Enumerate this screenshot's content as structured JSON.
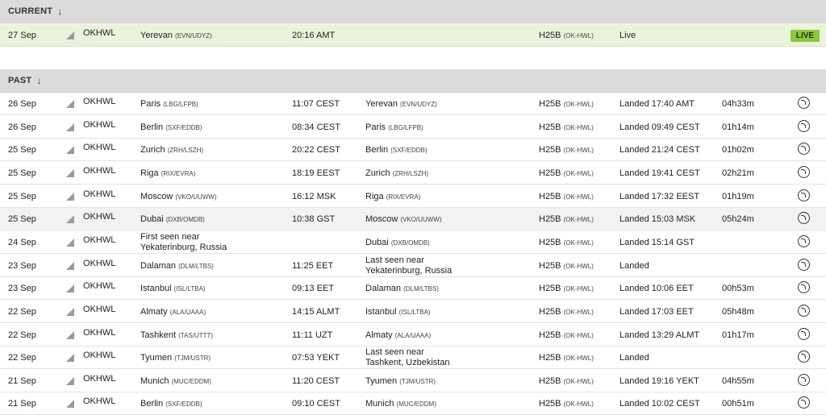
{
  "current": {
    "header": "CURRENT",
    "arrow": "↓",
    "row": {
      "date": "27 Sep",
      "reg": "OKHWL",
      "from_name": "Yerevan",
      "from_code": "(EVN/UDYZ)",
      "dep": "20:16 AMT",
      "aircraft": "H25B",
      "aircraft_reg": "(OK-HWL)",
      "status": "Live",
      "badge": "LIVE"
    }
  },
  "past": {
    "header": "PAST",
    "arrow": "↓",
    "rows": [
      {
        "date": "26 Sep",
        "reg": "OKHWL",
        "from_name": "Paris",
        "from_code": "(LBG/LFPB)",
        "from_l2": "",
        "dep": "11:07 CEST",
        "to_name": "Yerevan",
        "to_code": "(EVN/UDYZ)",
        "to_l2": "",
        "aircraft": "H25B",
        "aircraft_reg": "(OK-HWL)",
        "status": "Landed 17:40 AMT",
        "duration": "04h33m"
      },
      {
        "date": "26 Sep",
        "reg": "OKHWL",
        "from_name": "Berlin",
        "from_code": "(SXF/EDDB)",
        "from_l2": "",
        "dep": "08:34 CEST",
        "to_name": "Paris",
        "to_code": "(LBG/LFPB)",
        "to_l2": "",
        "aircraft": "H25B",
        "aircraft_reg": "(OK-HWL)",
        "status": "Landed 09:49 CEST",
        "duration": "01h14m"
      },
      {
        "date": "25 Sep",
        "reg": "OKHWL",
        "from_name": "Zurich",
        "from_code": "(ZRH/LSZH)",
        "from_l2": "",
        "dep": "20:22 CEST",
        "to_name": "Berlin",
        "to_code": "(SXF/EDDB)",
        "to_l2": "",
        "aircraft": "H25B",
        "aircraft_reg": "(OK-HWL)",
        "status": "Landed 21:24 CEST",
        "duration": "01h02m"
      },
      {
        "date": "25 Sep",
        "reg": "OKHWL",
        "from_name": "Riga",
        "from_code": "(RIX/EVRA)",
        "from_l2": "",
        "dep": "18:19 EEST",
        "to_name": "Zurich",
        "to_code": "(ZRH/LSZH)",
        "to_l2": "",
        "aircraft": "H25B",
        "aircraft_reg": "(OK-HWL)",
        "status": "Landed 19:41 CEST",
        "duration": "02h21m"
      },
      {
        "date": "25 Sep",
        "reg": "OKHWL",
        "from_name": "Moscow",
        "from_code": "(VKO/UUWW)",
        "from_l2": "",
        "dep": "16:12 MSK",
        "to_name": "Riga",
        "to_code": "(RIX/EVRA)",
        "to_l2": "",
        "aircraft": "H25B",
        "aircraft_reg": "(OK-HWL)",
        "status": "Landed 17:32 EEST",
        "duration": "01h19m"
      },
      {
        "date": "25 Sep",
        "reg": "OKHWL",
        "from_name": "Dubai",
        "from_code": "(DXB/OMDB)",
        "from_l2": "",
        "dep": "10:38 GST",
        "to_name": "Moscow",
        "to_code": "(VKO/UUWW)",
        "to_l2": "",
        "aircraft": "H25B",
        "aircraft_reg": "(OK-HWL)",
        "status": "Landed 15:03 MSK",
        "duration": "05h24m",
        "highlight": true
      },
      {
        "date": "24 Sep",
        "reg": "OKHWL",
        "from_name": "First seen near",
        "from_code": "",
        "from_l2": "Yekaterinburg, Russia",
        "dep": "",
        "to_name": "Dubai",
        "to_code": "(DXB/OMDB)",
        "to_l2": "",
        "aircraft": "H25B",
        "aircraft_reg": "(OK-HWL)",
        "status": "Landed 15:14 GST",
        "duration": ""
      },
      {
        "date": "23 Sep",
        "reg": "OKHWL",
        "from_name": "Dalaman",
        "from_code": "(DLM/LTBS)",
        "from_l2": "",
        "dep": "11:25 EET",
        "to_name": "Last seen near",
        "to_code": "",
        "to_l2": "Yekaterinburg, Russia",
        "aircraft": "H25B",
        "aircraft_reg": "(OK-HWL)",
        "status": "Landed",
        "duration": ""
      },
      {
        "date": "23 Sep",
        "reg": "OKHWL",
        "from_name": "Istanbul",
        "from_code": "(ISL/LTBA)",
        "from_l2": "",
        "dep": "09:13 EET",
        "to_name": "Dalaman",
        "to_code": "(DLM/LTBS)",
        "to_l2": "",
        "aircraft": "H25B",
        "aircraft_reg": "(OK-HWL)",
        "status": "Landed 10:06 EET",
        "duration": "00h53m"
      },
      {
        "date": "22 Sep",
        "reg": "OKHWL",
        "from_name": "Almaty",
        "from_code": "(ALA/UAAA)",
        "from_l2": "",
        "dep": "14:15 ALMT",
        "to_name": "Istanbul",
        "to_code": "(ISL/LTBA)",
        "to_l2": "",
        "aircraft": "H25B",
        "aircraft_reg": "(OK-HWL)",
        "status": "Landed 17:03 EET",
        "duration": "05h48m"
      },
      {
        "date": "22 Sep",
        "reg": "OKHWL",
        "from_name": "Tashkent",
        "from_code": "(TAS/UTTT)",
        "from_l2": "",
        "dep": "11:11 UZT",
        "to_name": "Almaty",
        "to_code": "(ALA/UAAA)",
        "to_l2": "",
        "aircraft": "H25B",
        "aircraft_reg": "(OK-HWL)",
        "status": "Landed 13:29 ALMT",
        "duration": "01h17m"
      },
      {
        "date": "22 Sep",
        "reg": "OKHWL",
        "from_name": "Tyumen",
        "from_code": "(TJM/USTR)",
        "from_l2": "",
        "dep": "07:53 YEKT",
        "to_name": "Last seen near",
        "to_code": "",
        "to_l2": "Tashkent, Uzbekistan",
        "aircraft": "H25B",
        "aircraft_reg": "(OK-HWL)",
        "status": "Landed",
        "duration": ""
      },
      {
        "date": "21 Sep",
        "reg": "OKHWL",
        "from_name": "Munich",
        "from_code": "(MUC/EDDM)",
        "from_l2": "",
        "dep": "11:20 CEST",
        "to_name": "Tyumen",
        "to_code": "(TJM/USTR)",
        "to_l2": "",
        "aircraft": "H25B",
        "aircraft_reg": "(OK-HWL)",
        "status": "Landed 19:16 YEKT",
        "duration": "04h55m"
      },
      {
        "date": "21 Sep",
        "reg": "OKHWL",
        "from_name": "Berlin",
        "from_code": "(SXF/EDDB)",
        "from_l2": "",
        "dep": "09:10 CEST",
        "to_name": "Munich",
        "to_code": "(MUC/EDDM)",
        "to_l2": "",
        "aircraft": "H25B",
        "aircraft_reg": "(OK-HWL)",
        "status": "Landed 10:02 CEST",
        "duration": "00h51m"
      }
    ]
  },
  "icons": {
    "plane": "plane-icon",
    "playback": "playback-icon",
    "sort": "arrow-down-icon"
  },
  "colors": {
    "header_bg": "#dcdcdc",
    "current_row_bg": "#eaf3dc",
    "live_badge": "#8dc63f"
  }
}
